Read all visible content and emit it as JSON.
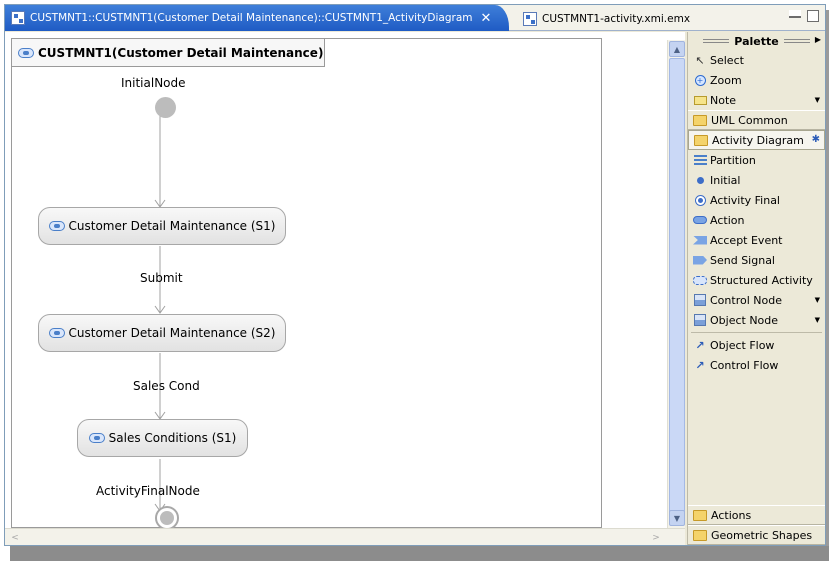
{
  "editor": {
    "active_tab_label": "CUSTMNT1::CUSTMNT1(Customer Detail Maintenance)::CUSTMNT1_ActivityDiagram",
    "active_tab_close": "✕",
    "inactive_tab_label": "CUSTMNT1-activity.xmi.emx"
  },
  "diagram": {
    "frame_title": "CUSTMNT1(Customer Detail Maintenance)",
    "initial_node_label": "InitialNode",
    "final_node_label": "ActivityFinalNode",
    "actions": [
      {
        "label": "Customer Detail Maintenance (S1)"
      },
      {
        "label": "Customer Detail Maintenance (S2)"
      },
      {
        "label": "Sales Conditions (S1)"
      }
    ],
    "edge_labels": [
      "Submit",
      "Sales Cond"
    ]
  },
  "palette": {
    "title": "Palette",
    "tools": [
      {
        "label": "Select",
        "icon": "select-arrow-icon"
      },
      {
        "label": "Zoom",
        "icon": "zoom-icon"
      },
      {
        "label": "Note",
        "icon": "note-icon"
      }
    ],
    "drawers": {
      "uml_common": "UML Common",
      "activity_diagram": "Activity Diagram",
      "actions": "Actions",
      "geometric_shapes": "Geometric Shapes"
    },
    "activity_items": [
      {
        "label": "Partition",
        "icon": "partition-icon"
      },
      {
        "label": "Initial",
        "icon": "initial-node-icon"
      },
      {
        "label": "Activity Final",
        "icon": "activity-final-icon"
      },
      {
        "label": "Action",
        "icon": "action-icon"
      },
      {
        "label": "Accept Event",
        "icon": "accept-event-icon"
      },
      {
        "label": "Send Signal",
        "icon": "send-signal-icon"
      },
      {
        "label": "Structured Activity",
        "icon": "structured-activity-icon"
      },
      {
        "label": "Control Node",
        "icon": "control-node-icon"
      },
      {
        "label": "Object Node",
        "icon": "object-node-icon"
      }
    ],
    "flow_items": [
      {
        "label": "Object Flow",
        "icon": "object-flow-icon"
      },
      {
        "label": "Control Flow",
        "icon": "control-flow-icon"
      }
    ]
  },
  "colors": {
    "active_tab": "#1f5bc4",
    "palette_bg": "#ece9d8",
    "node_gray": "#bcbcbc"
  }
}
